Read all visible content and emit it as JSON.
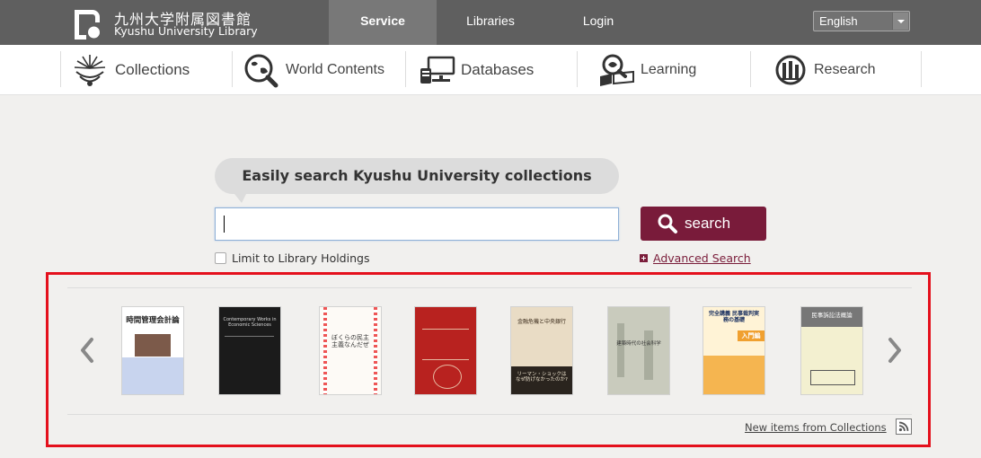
{
  "header": {
    "logo_ja": "九州大学附属図書館",
    "logo_en": "Kyushu University Library",
    "tabs": [
      {
        "label": "Service",
        "active": true
      },
      {
        "label": "Libraries",
        "active": false
      },
      {
        "label": "Login",
        "active": false
      }
    ],
    "language": "English"
  },
  "categories": [
    {
      "label": "Collections",
      "icon": "collections-icon"
    },
    {
      "label": "World Contents",
      "icon": "world-contents-icon"
    },
    {
      "label": "Databases",
      "icon": "databases-icon"
    },
    {
      "label": "Learning",
      "icon": "learning-icon"
    },
    {
      "label": "Research",
      "icon": "research-icon"
    }
  ],
  "search": {
    "heading": "Easily search Kyushu University collections",
    "input_value": "",
    "button_label": "search",
    "limit_label": "Limit to Library Holdings",
    "limit_checked": false,
    "advanced_label": "Advanced Search"
  },
  "new_items": {
    "books": [
      {
        "title": "時間管理会計論",
        "sub": "",
        "bg": "#ffffff",
        "fg": "#222222"
      },
      {
        "title": "Contemporary Works in Economic Sciences",
        "sub": "",
        "bg": "#1b1b1b",
        "fg": "#dddddd"
      },
      {
        "title": "ぼくらの民主主義なんだぜ",
        "sub": "",
        "bg": "#fdfaf6",
        "fg": "#333333"
      },
      {
        "title": "",
        "sub": "",
        "bg": "#b8221f",
        "fg": "#f0d7c5"
      },
      {
        "title": "金融危機と中央銀行",
        "sub": "リーマン・ショックはなぜ防げなかったのか?",
        "bg": "#e9dcc5",
        "fg": "#3a2a1a"
      },
      {
        "title": "建築時代の社会科学",
        "sub": "",
        "bg": "#c9cbbd",
        "fg": "#333333"
      },
      {
        "title": "完全講義 民事裁判実務の基礎",
        "sub": "入門編",
        "bg": "#fff3d6",
        "fg": "#1a3060"
      },
      {
        "title": "民事訴訟法概論",
        "sub": "",
        "bg": "#f3f0d0",
        "fg": "#222222"
      }
    ],
    "link_label": "New items from Collections"
  },
  "colors": {
    "brand": "#791b3a",
    "topbar": "#5f5f5f",
    "highlight_frame": "#e4101c"
  }
}
